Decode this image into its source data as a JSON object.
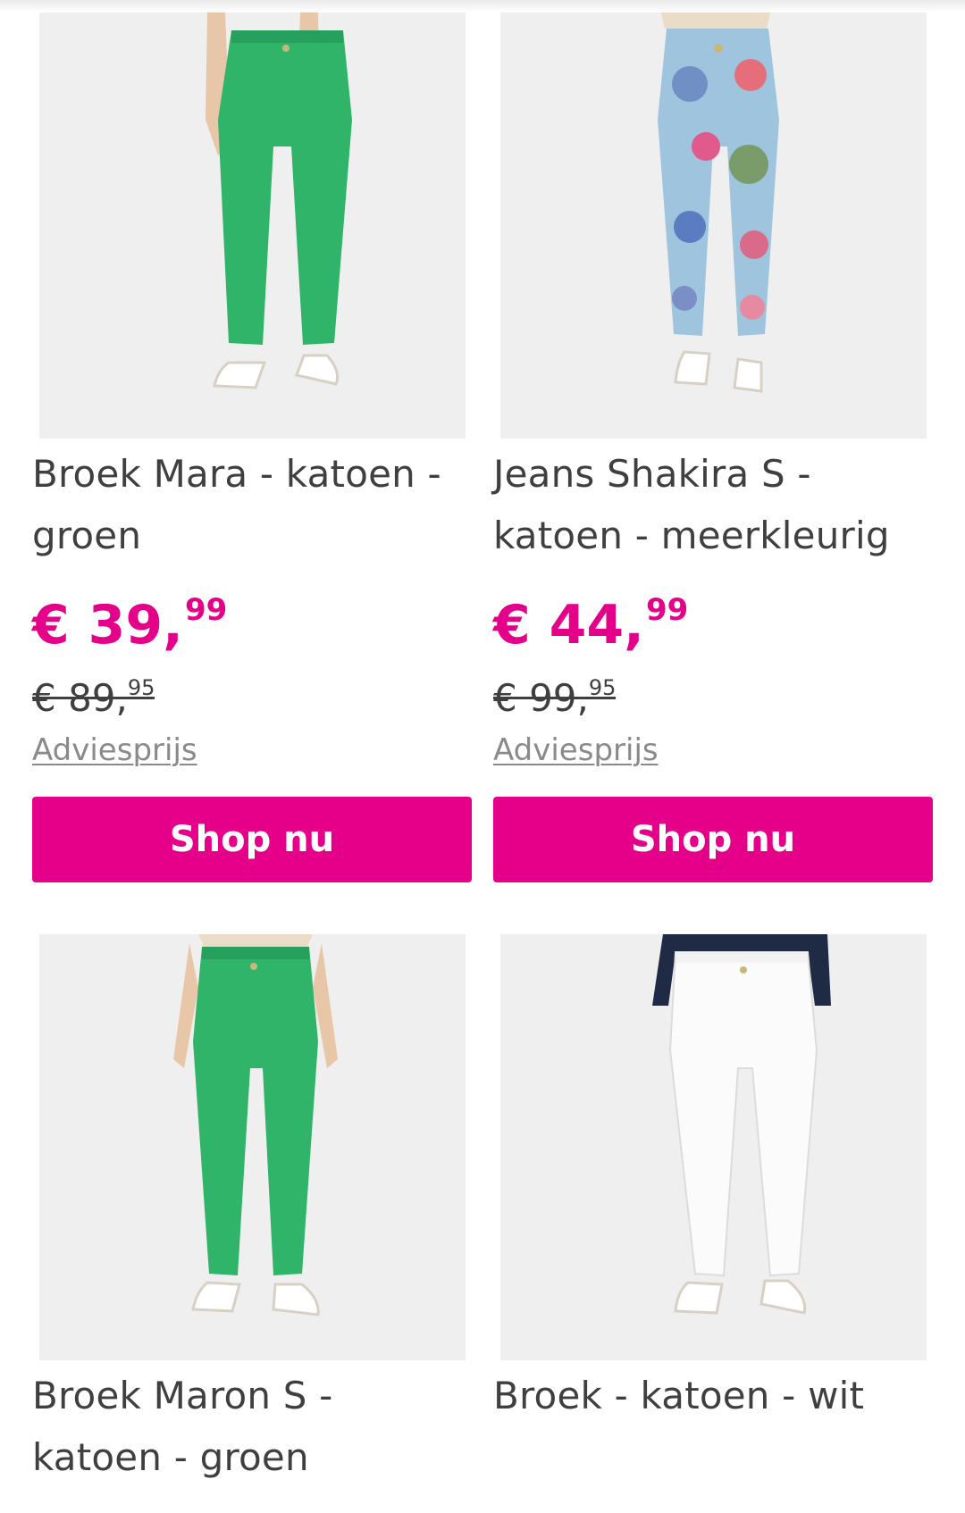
{
  "products": [
    {
      "title_line1": "Broek Mara - katoen -",
      "title_line2": "groen",
      "price_int": "€ 39,",
      "price_dec": "99",
      "old_price_int": "€ 89,",
      "old_price_dec": "95",
      "advice_label": "Adviesprijs",
      "button_label": "Shop nu",
      "pants_color": "#2fb46a"
    },
    {
      "title_line1": "Jeans Shakira S -",
      "title_line2": "katoen - meerkleurig",
      "price_int": "€ 44,",
      "price_dec": "99",
      "old_price_int": "€ 99,",
      "old_price_dec": "95",
      "advice_label": "Adviesprijs",
      "button_label": "Shop nu",
      "pants_color": "#9fc4de"
    },
    {
      "title_line1": "Broek Maron S -",
      "title_line2": "katoen - groen",
      "pants_color": "#2fb46a"
    },
    {
      "title_line1": "Broek - katoen - wit",
      "title_line2": "",
      "pants_color": "#fbfbfb"
    }
  ],
  "colors": {
    "accent": "#e5008a",
    "text": "#3f3f3f",
    "muted": "#8a8a8a",
    "image_bg": "#efefef"
  }
}
